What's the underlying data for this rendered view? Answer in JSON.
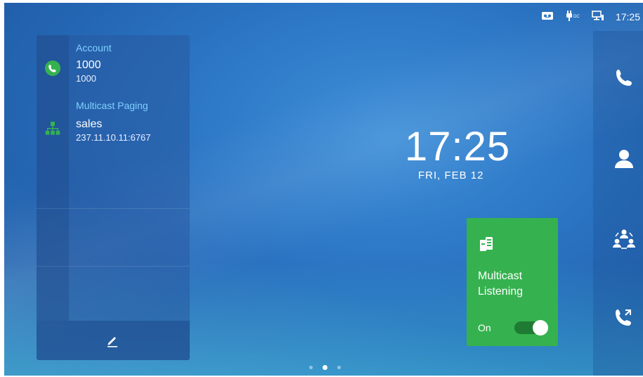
{
  "status": {
    "time": "17:25",
    "icons": [
      "voicemail-icon",
      "power-adapter-icon",
      "network-icon"
    ]
  },
  "accounts_panel": {
    "account": {
      "label": "Account",
      "name": "1000",
      "number": "1000",
      "icon": "phone-icon",
      "icon_color": "#35b24f"
    },
    "paging": {
      "label": "Multicast Paging",
      "name": "sales",
      "address": "237.11.10.11:6767",
      "icon": "network-tree-icon",
      "icon_color": "#35b24f"
    },
    "edit_icon": "pencil-icon"
  },
  "clock": {
    "time": "17:25",
    "date": "FRI, FEB 12"
  },
  "multicast_card": {
    "title_line1": "Multicast",
    "title_line2": "Listening",
    "state_label": "On",
    "toggle_on": true,
    "card_color": "#35b24f"
  },
  "right_bar": [
    "phone-icon",
    "contact-icon",
    "group-icon",
    "call-forward-icon"
  ],
  "pager": {
    "pages": 3,
    "active_index": 1
  }
}
